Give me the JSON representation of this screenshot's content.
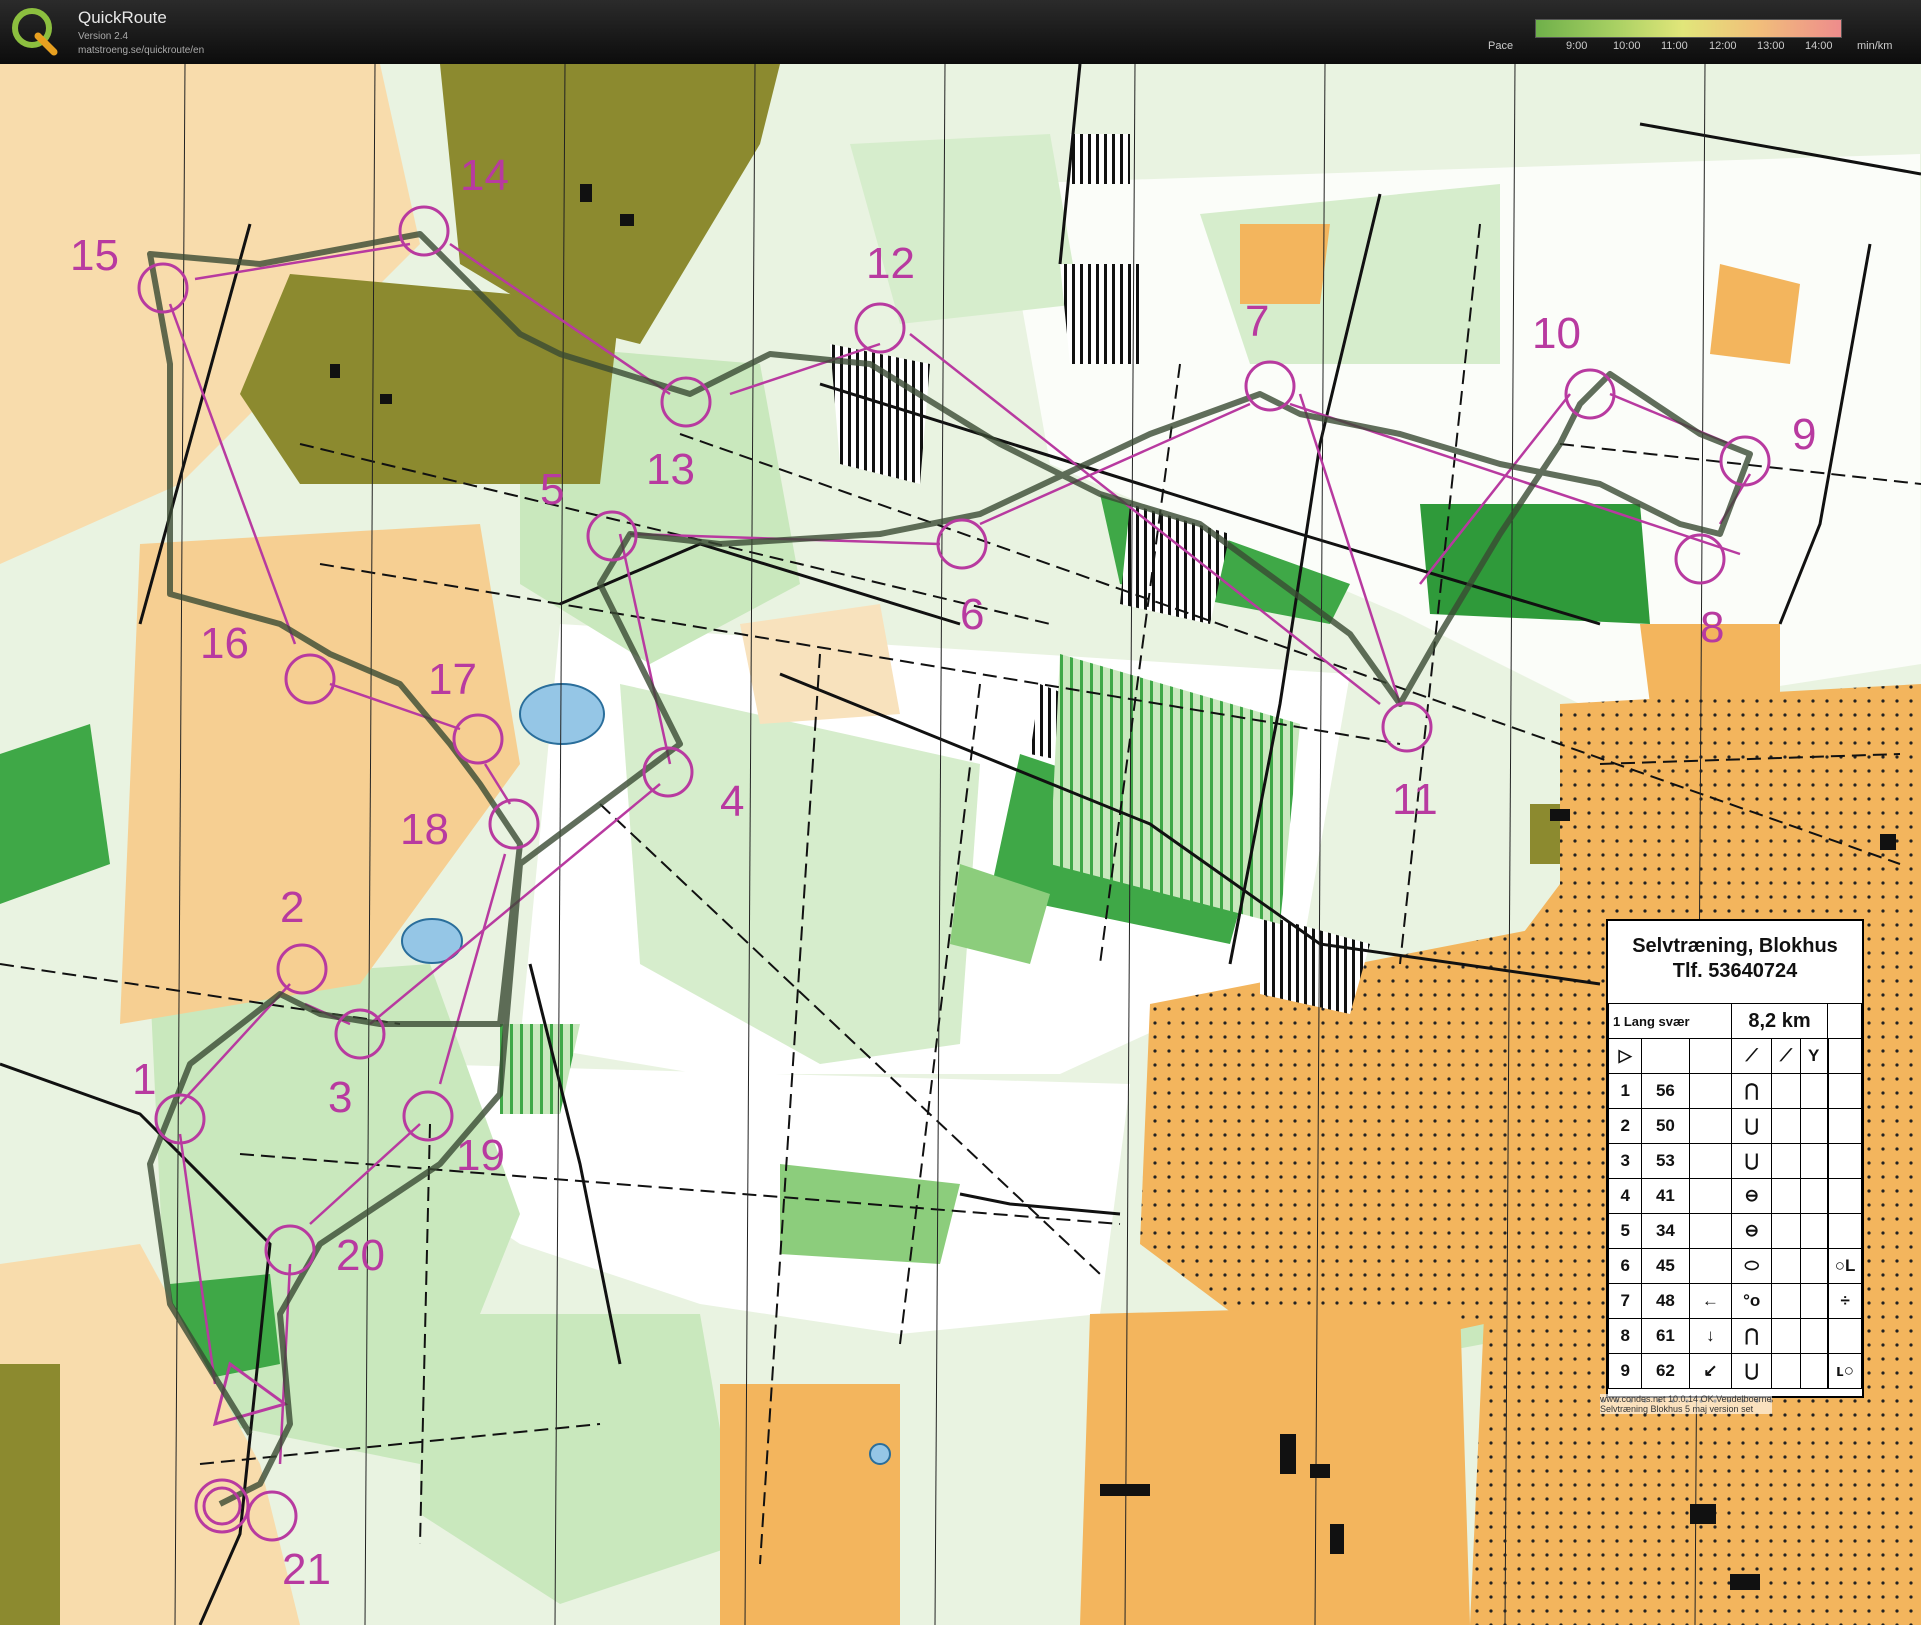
{
  "app": {
    "name": "QuickRoute",
    "version": "Version 2.4",
    "url": "matstroeng.se/quickroute/en"
  },
  "pace_scale": {
    "label": "Pace",
    "ticks": [
      "9:00",
      "10:00",
      "11:00",
      "12:00",
      "13:00",
      "14:00"
    ],
    "unit": "min/km"
  },
  "map": {
    "colors": {
      "open": "#f3b55d",
      "rough_open": "#f8dcac",
      "forest": "#ffffff",
      "green_light": "#c9e8bd",
      "green_mid": "#8ccd7c",
      "green_dark": "#3fa847",
      "olive": "#8c8a2f",
      "water": "#95c6e6",
      "course": "#b83aa0",
      "route": "#3a4a33"
    },
    "control_numbers": [
      "1",
      "2",
      "3",
      "4",
      "5",
      "6",
      "7",
      "8",
      "9",
      "10",
      "11",
      "12",
      "13",
      "14",
      "15",
      "16",
      "17",
      "18",
      "19",
      "20",
      "21"
    ]
  },
  "legend": {
    "title": "Selvtræning, Blokhus",
    "phone": "Tlf. 53640724",
    "course_name": "1 Lang svær",
    "length": "8,2 km",
    "rows": [
      {
        "n": "1",
        "code": "56",
        "arrow": "",
        "symbol": "⋂",
        "extra": ""
      },
      {
        "n": "2",
        "code": "50",
        "arrow": "",
        "symbol": "⋃",
        "extra": ""
      },
      {
        "n": "3",
        "code": "53",
        "arrow": "",
        "symbol": "⋃",
        "extra": ""
      },
      {
        "n": "4",
        "code": "41",
        "arrow": "",
        "symbol": "⊖",
        "extra": ""
      },
      {
        "n": "5",
        "code": "34",
        "arrow": "",
        "symbol": "⊖",
        "extra": ""
      },
      {
        "n": "6",
        "code": "45",
        "arrow": "",
        "symbol": "⬭",
        "extra": "○L"
      },
      {
        "n": "7",
        "code": "48",
        "arrow": "←",
        "symbol": "°o",
        "extra": "÷"
      },
      {
        "n": "8",
        "code": "61",
        "arrow": "↓",
        "symbol": "⋂",
        "extra": ""
      },
      {
        "n": "9",
        "code": "62",
        "arrow": "↙",
        "symbol": "⋃",
        "extra": "ʟ○"
      }
    ],
    "footer_1": "www.condes.net 10.0.14 OK Vendelboerne",
    "footer_2": "Selvtræning Blokhus 5 maj version set"
  }
}
